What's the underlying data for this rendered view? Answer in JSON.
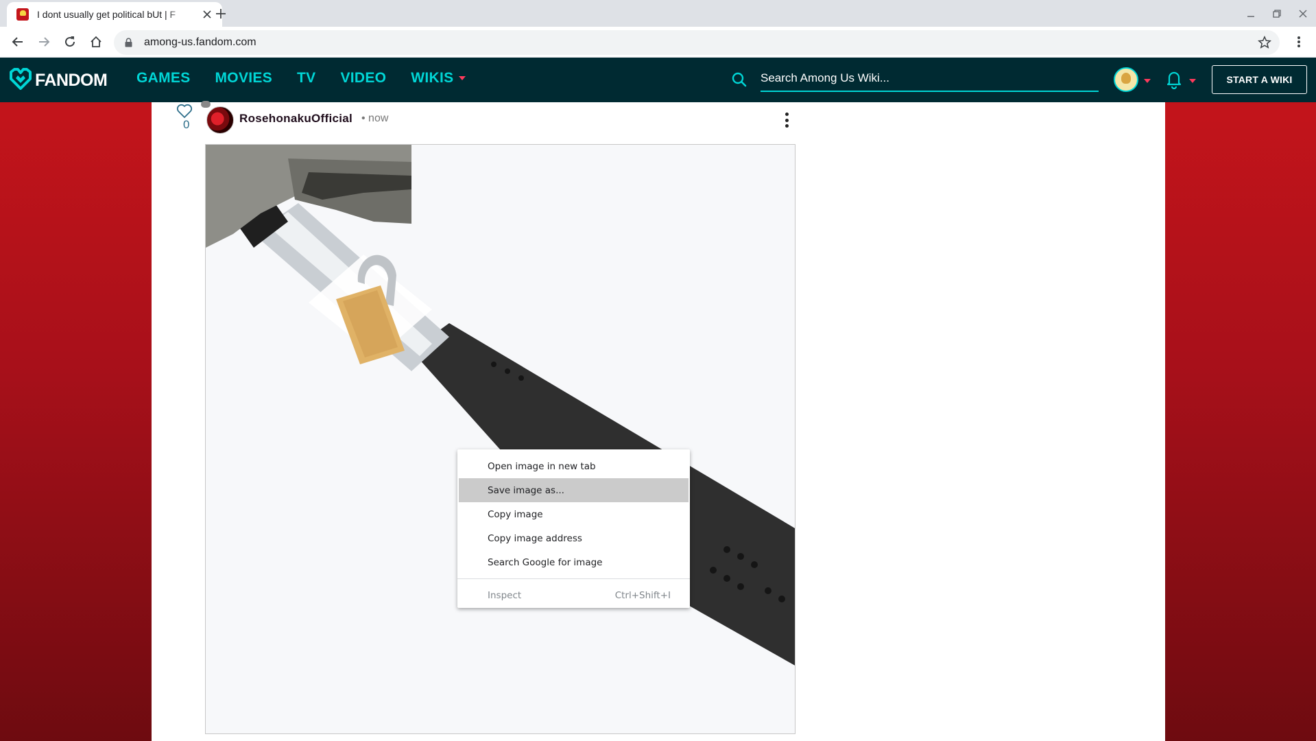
{
  "browser": {
    "tab_title": "I dont usually get political bUt | F",
    "url": "among-us.fandom.com"
  },
  "fandom": {
    "logo_text": "FANDOM",
    "nav": [
      {
        "label": "GAMES"
      },
      {
        "label": "MOVIES"
      },
      {
        "label": "TV"
      },
      {
        "label": "VIDEO"
      },
      {
        "label": "WIKIS"
      }
    ],
    "search_placeholder": "Search Among Us Wiki...",
    "start_wiki_label": "START A WIKI",
    "accent_color": "#00d6d6",
    "caret_color": "#fe3a5c",
    "bar_color": "#002a32"
  },
  "post": {
    "like_count": "0",
    "author": "RosehonakuOfficial",
    "time": "• now"
  },
  "context_menu": {
    "items": [
      {
        "label": "Open image in new tab"
      },
      {
        "label": "Save image as..."
      },
      {
        "label": "Copy image"
      },
      {
        "label": "Copy image address"
      },
      {
        "label": "Search Google for image"
      }
    ],
    "inspect_label": "Inspect",
    "inspect_shortcut": "Ctrl+Shift+I"
  }
}
